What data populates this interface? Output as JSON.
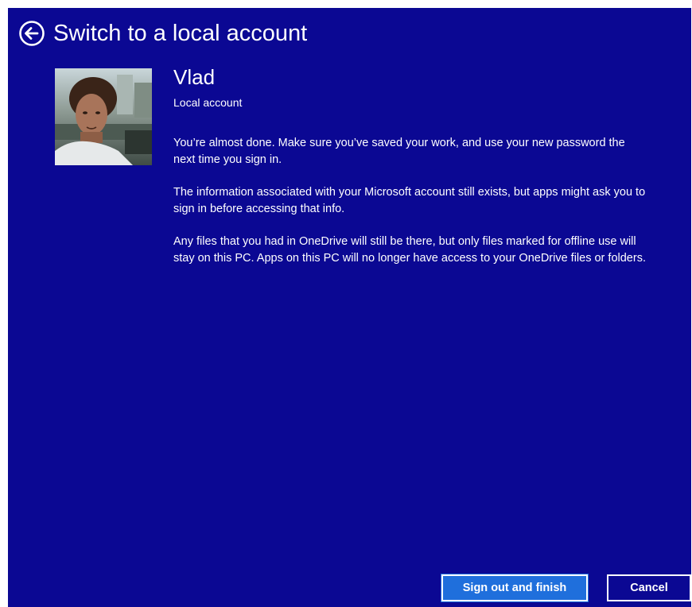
{
  "header": {
    "title": "Switch to a local account",
    "back_icon": "back-arrow-circle-icon"
  },
  "user": {
    "name": "Vlad",
    "account_type": "Local account",
    "avatar_icon": "user-photo"
  },
  "messages": [
    "You’re almost done. Make sure you’ve saved your work, and use your new password the next time you sign in.",
    "The information associated with your Microsoft account still exists, but apps might ask you to sign in before accessing that info.",
    "Any files that you had in OneDrive will still be there, but only files marked for offline use will stay on this PC. Apps on this PC will no longer have access to your OneDrive files or folders."
  ],
  "buttons": {
    "primary_label": "Sign out and finish",
    "secondary_label": "Cancel"
  },
  "colors": {
    "background": "#0b0893",
    "primary_button": "#1f6fdc",
    "text": "#ffffff"
  }
}
